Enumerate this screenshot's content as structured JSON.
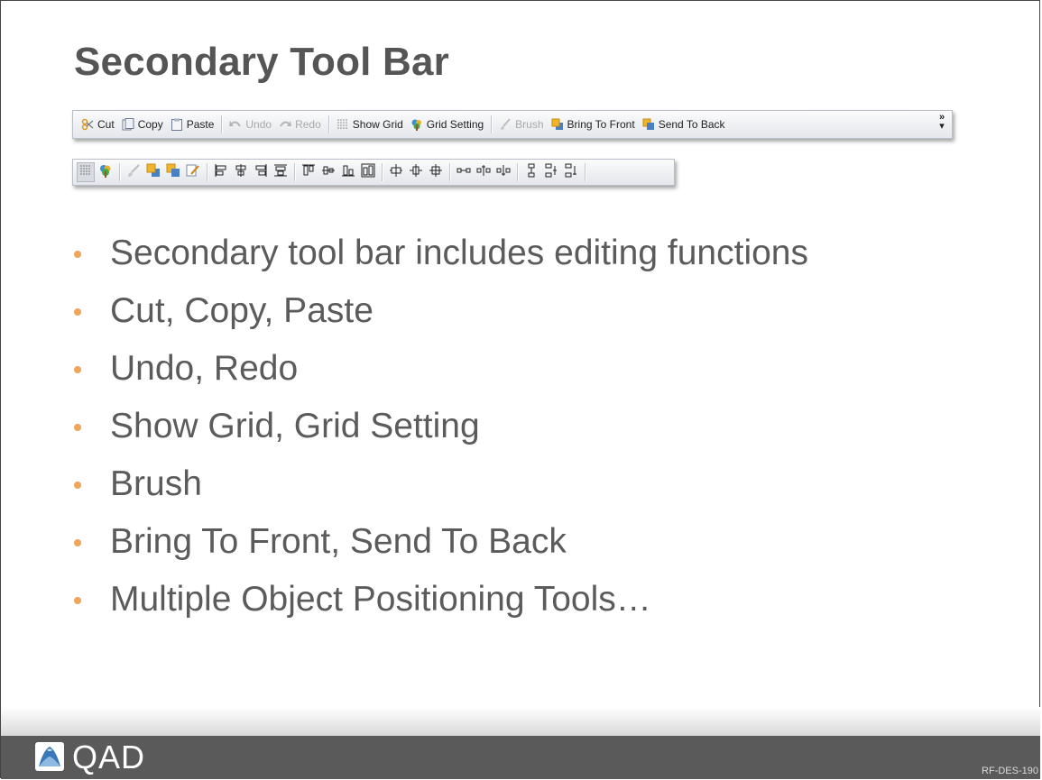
{
  "slide": {
    "title": "Secondary Tool Bar",
    "code": "RF-DES-190"
  },
  "toolbar": {
    "buttons": [
      {
        "label": "Cut",
        "icon": "scissors-icon",
        "enabled": true
      },
      {
        "label": "Copy",
        "icon": "copy-icon",
        "enabled": true
      },
      {
        "label": "Paste",
        "icon": "paste-icon",
        "enabled": true
      },
      {
        "label": "Undo",
        "icon": "undo-icon",
        "enabled": false
      },
      {
        "label": "Redo",
        "icon": "redo-icon",
        "enabled": false
      },
      {
        "label": "Show Grid",
        "icon": "grid-icon",
        "enabled": true
      },
      {
        "label": "Grid Setting",
        "icon": "grid-setting-icon",
        "enabled": true
      },
      {
        "label": "Brush",
        "icon": "brush-icon",
        "enabled": false
      },
      {
        "label": "Bring To Front",
        "icon": "bring-to-front-icon",
        "enabled": true
      },
      {
        "label": "Send To Back",
        "icon": "send-to-back-icon",
        "enabled": true
      }
    ],
    "overflow": "»"
  },
  "toolbar_compact": {
    "icons": [
      "grid-icon",
      "grid-setting-icon",
      "brush-icon",
      "bring-to-front-icon",
      "send-to-back-icon",
      "edit-icon",
      "align-left-icon",
      "align-center-icon",
      "align-right-icon",
      "align-middle-icon",
      "align-top-icon",
      "center-vertical-icon",
      "align-bottom-icon",
      "same-size-icon",
      "center-horizontally-icon",
      "center-both-icon",
      "distribute-icon",
      "horizontal-spacing-icon",
      "increase-horizontal-spacing-icon",
      "decrease-horizontal-spacing-icon",
      "vertical-spacing-icon",
      "increase-vertical-spacing-icon",
      "decrease-vertical-spacing-icon"
    ]
  },
  "bullets": [
    "Secondary tool bar includes editing functions",
    "Cut, Copy, Paste",
    "Undo, Redo",
    "Show Grid, Grid Setting",
    "Brush",
    "Bring To Front, Send To Back",
    "Multiple Object Positioning Tools…"
  ],
  "footer": {
    "logo_text": "QAD"
  },
  "colors": {
    "title": "#555555",
    "bullet_dot": "#f0a35b",
    "body_text": "#5b5b5b",
    "footer": "#5a5a5a"
  }
}
